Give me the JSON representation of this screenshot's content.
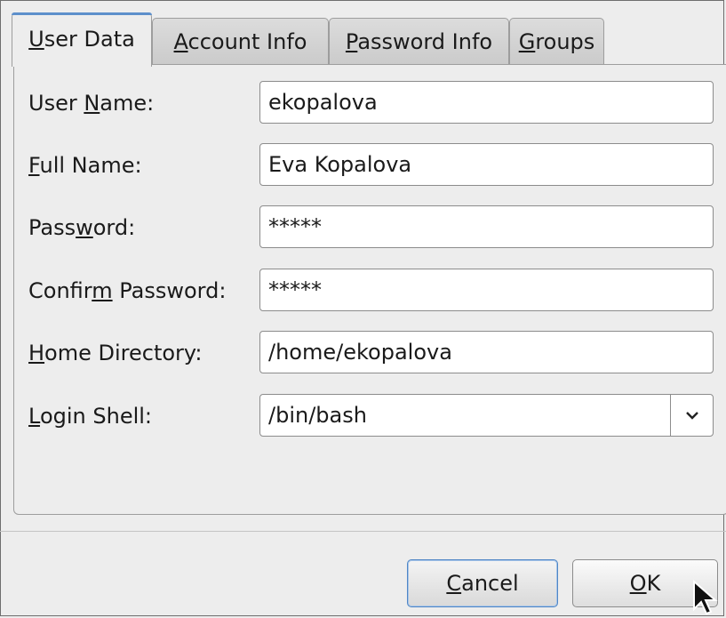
{
  "tabs": [
    {
      "pre": "",
      "mn": "U",
      "post": "ser Data",
      "active": true
    },
    {
      "pre": "",
      "mn": "A",
      "post": "ccount Info",
      "active": false
    },
    {
      "pre": "",
      "mn": "P",
      "post": "assword Info",
      "active": false
    },
    {
      "pre": "",
      "mn": "G",
      "post": "roups",
      "active": false
    }
  ],
  "form": {
    "user_name": {
      "pre": "User ",
      "mn": "N",
      "post": "ame:",
      "value": "ekopalova"
    },
    "full_name": {
      "pre": "",
      "mn": "F",
      "post": "ull Name:",
      "value": "Eva Kopalova"
    },
    "password": {
      "pre": "Pass",
      "mn": "w",
      "post": "ord:",
      "value": "*****"
    },
    "confirm_password": {
      "pre": "Confir",
      "mn": "m",
      "post": " Password:",
      "value": "*****"
    },
    "home_directory": {
      "pre": "",
      "mn": "H",
      "post": "ome Directory:",
      "value": "/home/ekopalova"
    },
    "login_shell": {
      "pre": "",
      "mn": "L",
      "post": "ogin Shell:",
      "value": "/bin/bash"
    }
  },
  "buttons": {
    "cancel": {
      "pre": "",
      "mn": "C",
      "post": "ancel"
    },
    "ok": {
      "pre": "",
      "mn": "O",
      "post": "K"
    }
  },
  "icons": {
    "combo_arrow": "chevron-down-icon",
    "cursor": "mouse-pointer-icon"
  },
  "colors": {
    "accent": "#5d8fcb",
    "background": "#ededed",
    "field": "#ffffff"
  }
}
